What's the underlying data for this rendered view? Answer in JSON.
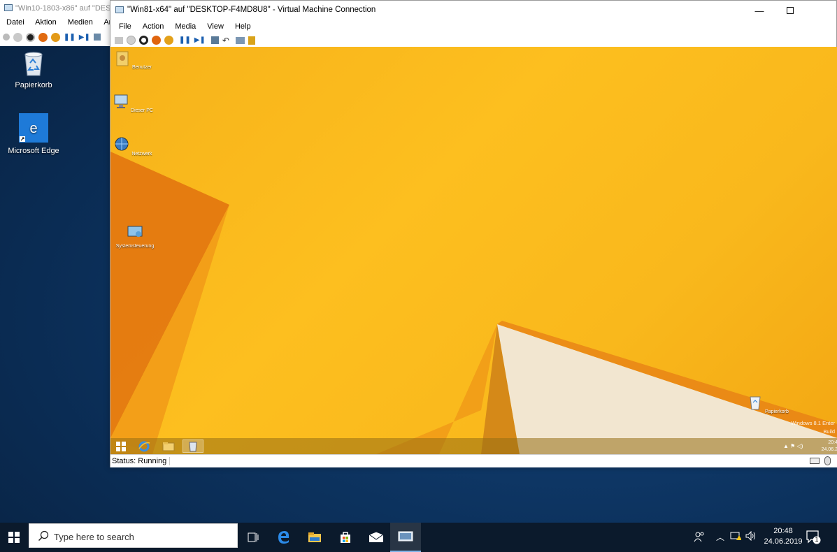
{
  "host": {
    "desktop_icons": [
      {
        "label": "Papierkorb",
        "icon": "recycle-bin-icon"
      },
      {
        "label": "Microsoft Edge",
        "icon": "edge-icon"
      }
    ],
    "back_window": {
      "title": "\"Win10-1803-x86\" auf \"DESK",
      "menu": [
        "Datei",
        "Aktion",
        "Medien",
        "Ans"
      ]
    },
    "taskbar": {
      "search_placeholder": "Type here to search",
      "apps": [
        "task-view-icon",
        "edge-icon",
        "file-explorer-icon",
        "store-icon",
        "mail-icon",
        "vm-connection-icon"
      ],
      "time": "20:48",
      "date": "24.06.2019",
      "notification_count": "1"
    }
  },
  "vm_window": {
    "title": "\"Win81-x64\" auf \"DESKTOP-F4MD8U8\" - Virtual Machine Connection",
    "menu": [
      "File",
      "Action",
      "Media",
      "View",
      "Help"
    ],
    "toolbar": [
      "ctrl-alt-del-icon",
      "start-icon",
      "turn-off-icon",
      "shutdown-icon",
      "save-icon",
      "pause-icon",
      "reset-icon",
      "checkpoint-icon",
      "revert-icon",
      "enhanced-session-icon",
      "basic-session-icon"
    ],
    "status": "Status: Running",
    "guest": {
      "desktop_icons": [
        "Benutzer",
        "Dieser PC",
        "Netzwerk",
        "Systemsteuerung"
      ],
      "recycle_label": "Papierkorb",
      "watermark_line1": "Windows 8.1 Enter",
      "watermark_line2": "Build",
      "clock_time": "20:4",
      "clock_date": "24.06.2"
    }
  },
  "colors": {
    "guest_orange": "#f9b81c",
    "host_blue": "#0e3766",
    "taskbar": "#0b1a2c"
  }
}
